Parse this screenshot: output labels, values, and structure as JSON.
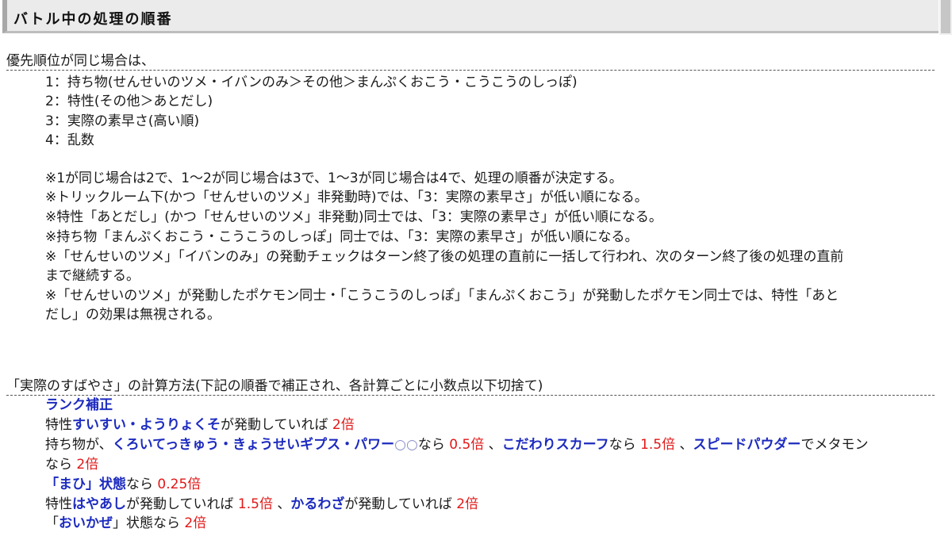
{
  "header": {
    "title": "バトル中の処理の順番"
  },
  "priority": {
    "heading": "優先順位が同じ場合は、",
    "items": [
      "1：持ち物(せんせいのツメ・イバンのみ＞その他＞まんぷくおこう・こうこうのしっぽ)",
      "2：特性(その他＞あとだし)",
      "3：実際の素早さ(高い順)",
      "4：乱数"
    ],
    "notes": [
      "※1が同じ場合は2で、1～2が同じ場合は3で、1～3が同じ場合は4で、処理の順番が決定する。",
      "※トリックルーム下(かつ「せんせいのツメ」非発動時)では、「3：実際の素早さ」が低い順になる。",
      "※特性「あとだし」(かつ「せんせいのツメ」非発動)同士では、「3：実際の素早さ」が低い順になる。",
      "※持ち物「まんぷくおこう・こうこうのしっぽ」同士では、「3：実際の素早さ」が低い順になる。",
      "※「せんせいのツメ」「イバンのみ」の発動チェックはターン終了後の処理の直前に一括して行われ、次のターン終了後の処理の直前",
      "まで継続する。",
      "※「せんせいのツメ」が発動したポケモン同士・「こうこうのしっぽ」「まんぷくおこう」が発動したポケモン同士では、特性「あと",
      "だし」の効果は無視される。"
    ]
  },
  "calc": {
    "heading": "「実際のすばやさ」の計算方法(下記の順番で補正され、各計算ごとに小数点以下切捨て)",
    "rank": "ランク補正",
    "r1": {
      "a": "特性",
      "b": "すいすい・ようりょくそ",
      "c": "が発動していれば ",
      "d": "2倍"
    },
    "r2": {
      "a": "持ち物が、",
      "b": "くろいてっきゅう・きょうせいギプス・パワー",
      "circ": "○○",
      "c": "なら ",
      "d": "0.5倍",
      "e": " 、",
      "f": "こだわりスカーフ",
      "g": "なら ",
      "h": "1.5倍",
      "i": " 、",
      "j": "スピードパウダー",
      "k": "でメタモン"
    },
    "r3": {
      "a": "なら ",
      "b": "2倍"
    },
    "r4": {
      "a": "「まひ」状態",
      "b": "なら ",
      "c": "0.25倍"
    },
    "r5": {
      "a": "特性",
      "b": "はやあし",
      "c": "が発動していれば ",
      "d": "1.5倍",
      "e": " 、",
      "f": "かるわざ",
      "g": "が発動していれば ",
      "h": "2倍"
    },
    "r6": {
      "a": "「",
      "b": "おいかぜ",
      "c": "」状態なら ",
      "d": "2倍"
    }
  }
}
